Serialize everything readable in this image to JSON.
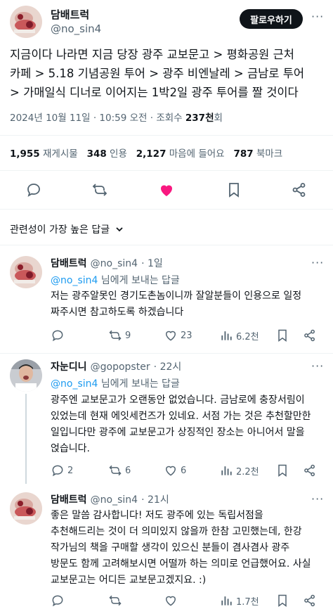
{
  "post": {
    "author_name": "담배트럭",
    "author_handle": "@no_sin4",
    "follow_label": "팔로우하기",
    "text_lines": [
      "지금이다 나라면 지금 당장 광주 교보문고 > 평화공원 근처",
      "카페 > 5.18 기념공원 투어 > 광주 비엔날레 > 금남로 투어",
      "> 가매일식 디너로 이어지는 1박2일 광주 투어를 짤 것이다"
    ],
    "timestamp": "2024년 10월 11일 · 10:59 오전 · 조회수 ",
    "views_value": "237천",
    "views_suffix": "회",
    "stats": {
      "reposts_value": "1,955",
      "reposts_label": "재게시물",
      "quotes_value": "348",
      "quotes_label": "인용",
      "likes_value": "2,127",
      "likes_label": "마음에 들어요",
      "bookmarks_value": "787",
      "bookmarks_label": "북마크"
    }
  },
  "sort": {
    "label": "관련성이 가장 높은 답글"
  },
  "replies": [
    {
      "name": "담배트럭",
      "handle": "@no_sin4",
      "time": "· 1일",
      "reply_to_handle": "@no_sin4",
      "reply_to_suffix": " 님에게 보내는 답글",
      "lines": [
        "저는 광주알못인 경기도촌놈이니까 잘알분들이 인용으로 일정",
        "짜주시면 참고하도록 하겠습니다"
      ],
      "replies_count": "",
      "reposts_count": "9",
      "likes_count": "23",
      "views_count": "6.2천"
    },
    {
      "name": "자눈디니",
      "handle": "@gopopster",
      "time": "· 22시",
      "reply_to_handle": "@no_sin4",
      "reply_to_suffix": " 님에게 보내는 답글",
      "lines": [
        "광주엔 교보문고가 오랜동안 없었습니다. 금남로에 충장서림이",
        "있었는데 현재 에잇세컨즈가 있네요. 서점 가는 것은 추천할만한",
        "일입니다만  광주에 교보문고가 상징적인 장소는 아니어서 말을",
        "얹습니다."
      ],
      "replies_count": "2",
      "reposts_count": "6",
      "likes_count": "6",
      "views_count": "2.2천"
    },
    {
      "name": "담배트럭",
      "handle": "@no_sin4",
      "time": "· 21시",
      "lines": [
        "좋은 말씀 감사합니다! 저도 광주에 있는 독립서점을",
        "추천해드리는 것이 더 의미있지 않을까 한참 고민했는데, 한강",
        "작가님의 책을 구매할 생각이 있으신 분들이 겸사겸사 광주",
        "방문도 함께 고려해보시면 어떨까 하는 의미로 언급했어요. 사실",
        "교보문고는 어디든 교보문고겠지요. :)"
      ],
      "replies_count": "",
      "reposts_count": "",
      "likes_count": "",
      "views_count": "1.7천"
    }
  ],
  "colors": {
    "accent": "#1d9bf0",
    "like_pink": "#f91880",
    "muted": "#536471",
    "follow_bg": "#0f1419"
  }
}
